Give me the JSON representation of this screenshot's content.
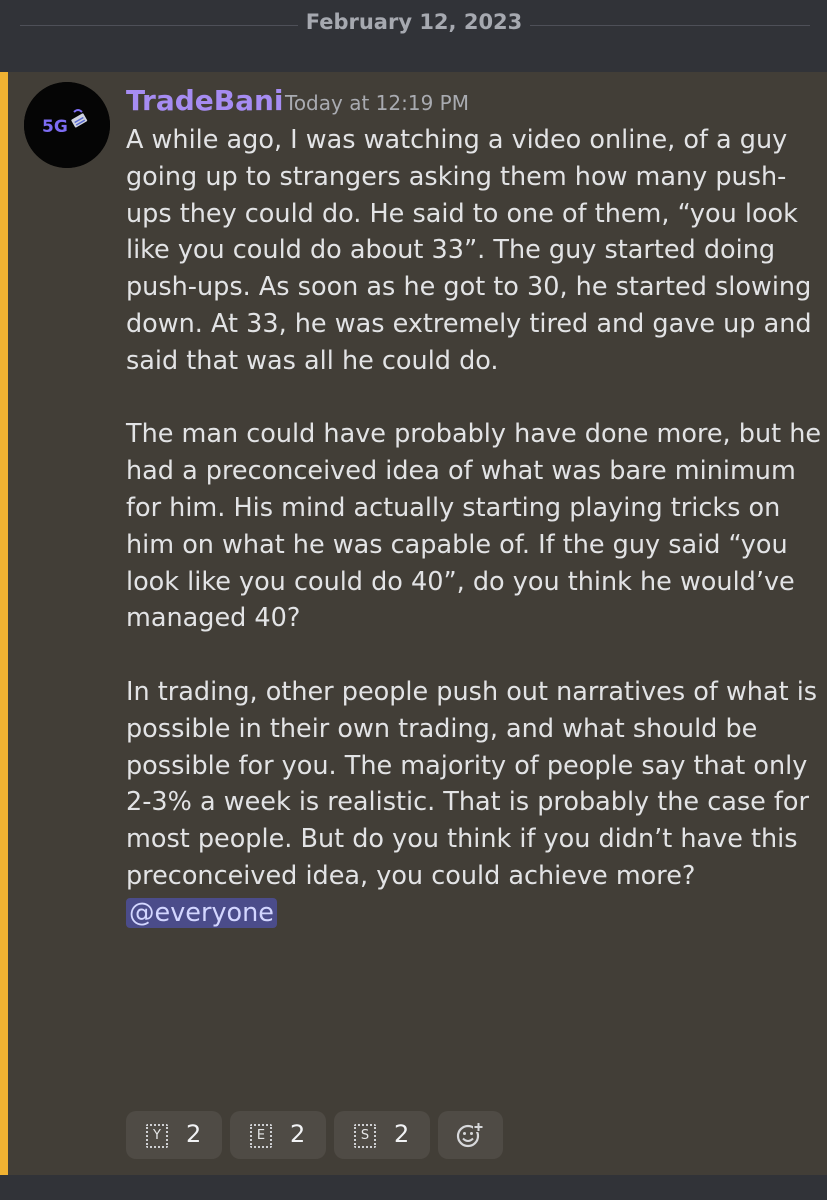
{
  "date_divider": {
    "text": "February 12, 2023"
  },
  "message": {
    "avatar": {
      "icon": "5g-logo",
      "text": "5G"
    },
    "author": "TradeBani",
    "timestamp": "Today at 12:19 PM",
    "paragraphs": [
      "A while ago, I was watching a video online, of a guy going up to strangers asking them how many push-ups they could do. He said to one of them, “you look like you could do about 33”. The guy started doing push-ups. As soon as he got to 30, he started slowing down. At 33, he was extremely tired and gave up and said that was all he could do.",
      "The man could have probably have done more, but he had a preconceived idea of what was bare minimum for him. His mind actually starting playing tricks on him on what he was capable of. If the guy said “you look like you could do 40”, do you think he would’ve managed 40?",
      "In trading, other people push out narratives of what is possible in their own trading, and what should be possible for you. The majority of people say that only 2-3% a week is realistic. That is probably the case for most people. But do you think if you didn’t have this preconceived idea, you could achieve more?"
    ],
    "mention": "@everyone",
    "reactions": [
      {
        "emoji": "Y",
        "count": "2"
      },
      {
        "emoji": "E",
        "count": "2"
      },
      {
        "emoji": "S",
        "count": "2"
      }
    ],
    "add_reaction_icon": "add-reaction-icon"
  },
  "colors": {
    "background": "#313338",
    "highlight_bg": "#423e37",
    "highlight_border": "#f0b232",
    "username": "#a68cf2",
    "mention_bg": "#4b4c8a"
  }
}
